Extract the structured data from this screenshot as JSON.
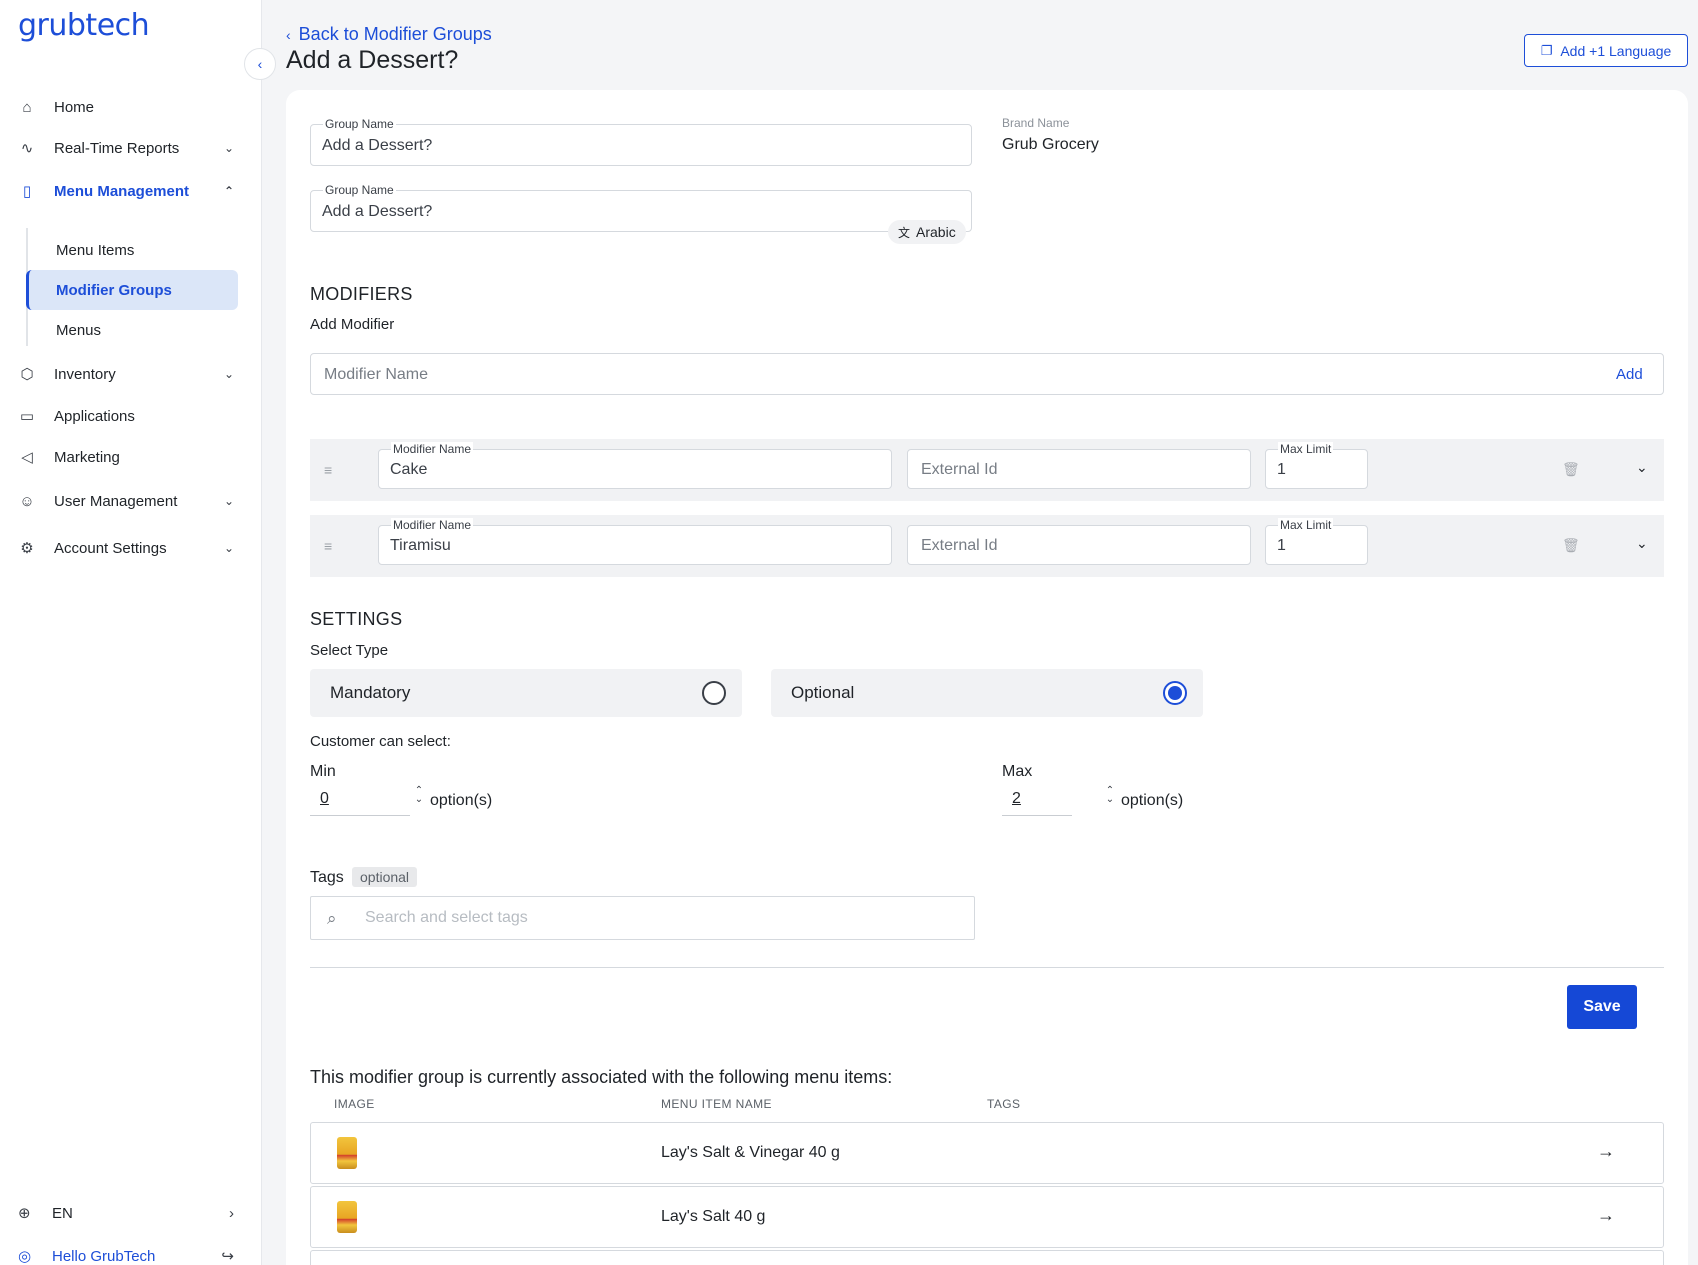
{
  "app": {
    "logo": "grubtech"
  },
  "sidebar": {
    "collapse_icon": "‹",
    "items": [
      {
        "label": "Home",
        "icon": "home-icon"
      },
      {
        "label": "Real-Time Reports",
        "icon": "activity-icon"
      },
      {
        "label": "Menu Management",
        "icon": "book-icon"
      },
      {
        "label": "Inventory",
        "icon": "box-icon"
      },
      {
        "label": "Applications",
        "icon": "monitor-icon"
      },
      {
        "label": "Marketing",
        "icon": "megaphone-icon"
      },
      {
        "label": "User Management",
        "icon": "users-icon"
      },
      {
        "label": "Account Settings",
        "icon": "gear-icon"
      }
    ],
    "sub_items": [
      {
        "label": "Menu Items"
      },
      {
        "label": "Modifier Groups"
      },
      {
        "label": "Menus"
      }
    ],
    "language": "EN",
    "user_greeting": "Hello GrubTech"
  },
  "header": {
    "back_link": "Back to Modifier Groups",
    "title": "Add a Dessert?",
    "add_language": "Add +1 Language"
  },
  "form": {
    "group_name_label": "Group Name",
    "group_name_value": "Add a Dessert?",
    "group_name_ar_label": "Group Name",
    "group_name_ar_value": "Add a Dessert?",
    "arabic_chip": "Arabic",
    "brand_label": "Brand Name",
    "brand_value": "Grub Grocery"
  },
  "modifiers": {
    "section_title": "MODIFIERS",
    "add_modifier_label": "Add Modifier",
    "input_placeholder": "Modifier Name",
    "add_button": "Add",
    "name_label": "Modifier Name",
    "external_placeholder": "External Id",
    "max_label": "Max Limit",
    "rows": [
      {
        "name": "Cake",
        "max": "1"
      },
      {
        "name": "Tiramisu",
        "max": "1"
      }
    ]
  },
  "settings": {
    "section_title": "SETTINGS",
    "select_type_label": "Select Type",
    "options": [
      {
        "label": "Mandatory",
        "selected": false
      },
      {
        "label": "Optional",
        "selected": true
      }
    ],
    "customer_can_select": "Customer can select:",
    "min_label": "Min",
    "min_value": "0",
    "max_label": "Max",
    "max_value": "2",
    "option_suffix": "option(s)"
  },
  "tags": {
    "label": "Tags",
    "badge": "optional",
    "placeholder": "Search and select tags"
  },
  "save_button": "Save",
  "associated": {
    "title": "This modifier group is currently associated with the following menu items:",
    "columns": [
      "IMAGE",
      "MENU ITEM NAME",
      "TAGS"
    ],
    "items": [
      {
        "name": "Lay's Salt & Vinegar 40 g"
      },
      {
        "name": "Lay's Salt 40 g"
      }
    ]
  },
  "colors": {
    "accent": "#1d4ed8",
    "save": "#1548d6",
    "row_bg": "#f1f2f4",
    "page_bg": "#f4f5f7"
  }
}
